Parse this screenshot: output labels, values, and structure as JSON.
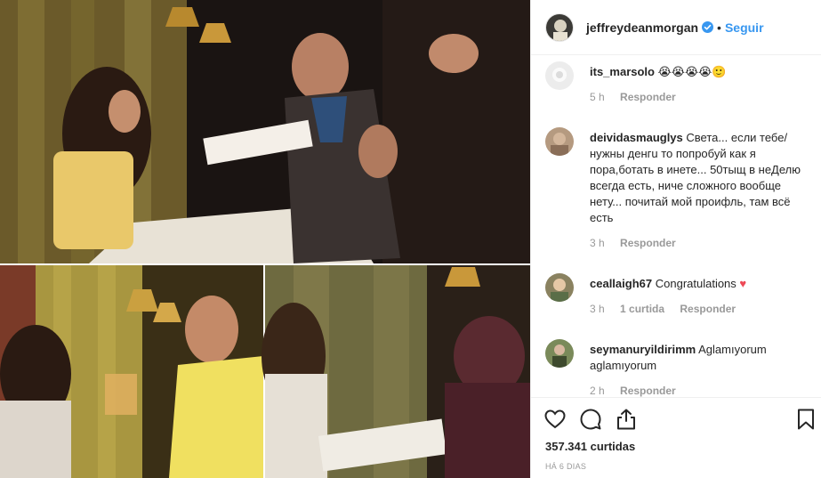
{
  "header": {
    "username": "jeffreydeanmorgan",
    "separator": "•",
    "follow_label": "Seguir"
  },
  "comments": [
    {
      "username": "its_marsolo",
      "text": "😭😭😭😭🙂",
      "time": "5 h",
      "likes": "",
      "reply_label": "Responder"
    },
    {
      "username": "deividasmauglys",
      "text": "Света... если тебе/ нужны денгu то попробуй как я пора,ботать в инете... 50тыщ в неДелю всегда есть, ниче сложного вообще нету... почитай мой проифль, там всё есть",
      "time": "3 h",
      "likes": "",
      "reply_label": "Responder"
    },
    {
      "username": "ceallaigh67",
      "text": "Congratulations",
      "heart": "♥",
      "time": "3 h",
      "likes": "1 curtida",
      "reply_label": "Responder"
    },
    {
      "username": "seymanuryildirimm",
      "text": "Aglamıyorum aglamıyorum",
      "time": "2 h",
      "likes": "",
      "reply_label": "Responder"
    }
  ],
  "actions": {
    "like_count": "357.341 curtidas",
    "time_ago": "HÁ 6 DIAS"
  },
  "colors": {
    "link": "#3897f0",
    "heart": "#ed4956",
    "muted": "#999999"
  }
}
